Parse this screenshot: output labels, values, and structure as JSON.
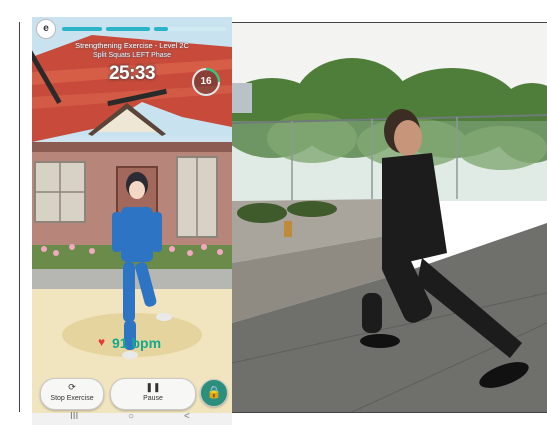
{
  "app": {
    "profile_initial": "e",
    "exercise_title": "Strengthening Exercise - Level 2C",
    "phase": "Split Squats LEFT Phase",
    "timer": "25:33",
    "rep_count": "16",
    "heart_rate": "91 bpm",
    "progress_segments": [
      1.0,
      1.0,
      0.2
    ],
    "buttons": {
      "stop": {
        "label": "Stop Exercise",
        "icon": "refresh-icon"
      },
      "pause": {
        "label": "Pause",
        "icon": "pause-icon"
      },
      "lock": {
        "icon": "lock-icon"
      }
    },
    "nav": {
      "recents": "III",
      "home": "○",
      "back": "<"
    }
  },
  "colors": {
    "accent": "#2bb3c8",
    "bpm": "#16a98c",
    "lock_button": "#2c8f7d",
    "heart": "#e23b3b"
  }
}
